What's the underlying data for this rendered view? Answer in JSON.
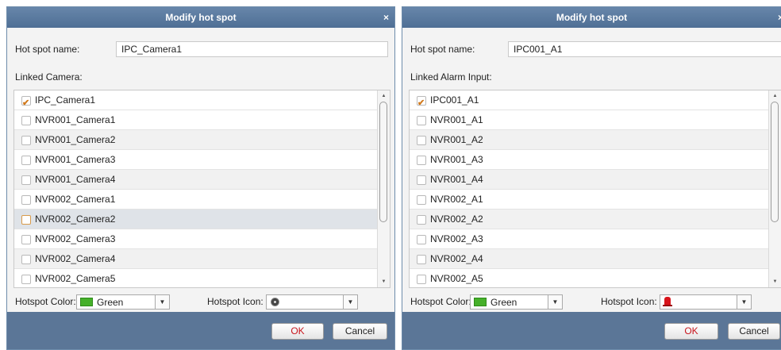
{
  "dialogs": [
    {
      "title": "Modify hot spot",
      "close": "×",
      "name_label": "Hot spot name:",
      "name_value": "IPC_Camera1",
      "linked_label": "Linked Camera:",
      "items": [
        {
          "label": "IPC_Camera1",
          "checked": true
        },
        {
          "label": "NVR001_Camera1",
          "checked": false
        },
        {
          "label": "NVR001_Camera2",
          "checked": false
        },
        {
          "label": "NVR001_Camera3",
          "checked": false
        },
        {
          "label": "NVR001_Camera4",
          "checked": false
        },
        {
          "label": "NVR002_Camera1",
          "checked": false
        },
        {
          "label": "NVR002_Camera2",
          "checked": false
        },
        {
          "label": "NVR002_Camera3",
          "checked": false
        },
        {
          "label": "NVR002_Camera4",
          "checked": false
        },
        {
          "label": "NVR002_Camera5",
          "checked": false
        }
      ],
      "color_label": "Hotspot Color:",
      "color_value": "Green",
      "icon_label": "Hotspot Icon:",
      "icon_name": "camera-icon",
      "ok": "OK",
      "cancel": "Cancel"
    },
    {
      "title": "Modify hot spot",
      "close": "×",
      "name_label": "Hot spot name:",
      "name_value": "IPC001_A1",
      "linked_label": "Linked Alarm Input:",
      "items": [
        {
          "label": "IPC001_A1",
          "checked": true
        },
        {
          "label": "NVR001_A1",
          "checked": false
        },
        {
          "label": "NVR001_A2",
          "checked": false
        },
        {
          "label": "NVR001_A3",
          "checked": false
        },
        {
          "label": "NVR001_A4",
          "checked": false
        },
        {
          "label": "NVR002_A1",
          "checked": false
        },
        {
          "label": "NVR002_A2",
          "checked": false
        },
        {
          "label": "NVR002_A3",
          "checked": false
        },
        {
          "label": "NVR002_A4",
          "checked": false
        },
        {
          "label": "NVR002_A5",
          "checked": false
        }
      ],
      "color_label": "Hotspot Color:",
      "color_value": "Green",
      "icon_label": "Hotspot Icon:",
      "icon_name": "alarm-light-icon",
      "ok": "OK",
      "cancel": "Cancel"
    }
  ],
  "colors": {
    "titlebar": "#5a7aa0",
    "footer": "#5b7697",
    "swatch_green": "#46b02a",
    "check": "#d0781a",
    "ok_text": "#c8161d"
  }
}
